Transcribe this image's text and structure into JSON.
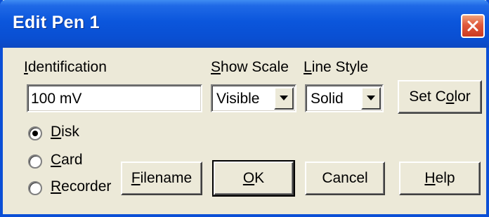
{
  "window": {
    "title": "Edit Pen 1"
  },
  "labels": {
    "identification": "Identification",
    "show_scale": "Show Scale",
    "line_style": "Line Style"
  },
  "identification_field": {
    "value": "100 mV"
  },
  "show_scale_select": {
    "selected": "Visible"
  },
  "line_style_select": {
    "selected": "Solid"
  },
  "buttons": {
    "set_color": "Set Color",
    "filename": "Filename",
    "ok": "OK",
    "cancel": "Cancel",
    "help": "Help"
  },
  "radios": [
    {
      "label": "Disk",
      "checked": true
    },
    {
      "label": "Card",
      "checked": false
    },
    {
      "label": "Recorder",
      "checked": false
    }
  ],
  "colors": {
    "titlebar": "#0b56dc",
    "dialog_bg": "#ece9d8",
    "close_button": "#e0593c"
  }
}
